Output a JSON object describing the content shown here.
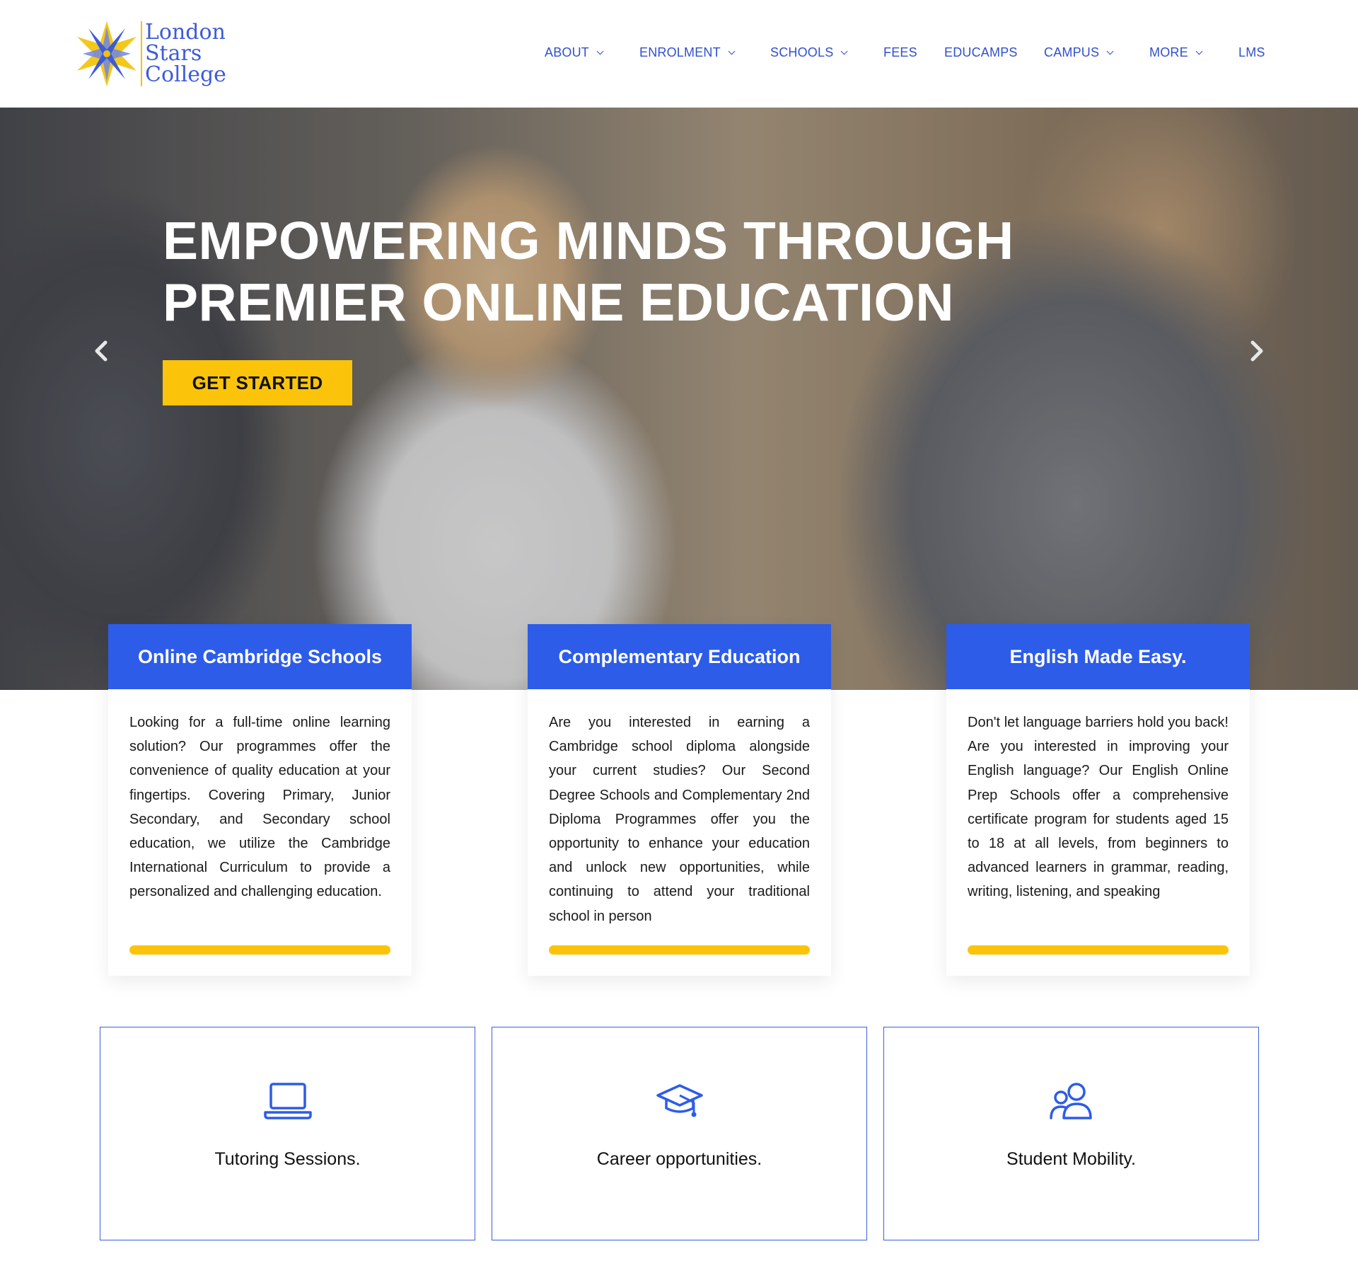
{
  "brand": {
    "line1": "London",
    "line2": "Stars",
    "line3": "College",
    "colors": {
      "blue": "#3d5bd9",
      "gold": "#f2c200"
    }
  },
  "nav": {
    "items": [
      {
        "label": "ABOUT",
        "has_dropdown": true
      },
      {
        "label": "ENROLMENT",
        "has_dropdown": true
      },
      {
        "label": "SCHOOLS",
        "has_dropdown": true
      },
      {
        "label": "FEES",
        "has_dropdown": false
      },
      {
        "label": "EDUCAMPS",
        "has_dropdown": false
      },
      {
        "label": "CAMPUS",
        "has_dropdown": true
      },
      {
        "label": "MORE",
        "has_dropdown": true
      },
      {
        "label": "LMS",
        "has_dropdown": false
      }
    ],
    "dropdown_icon": "chevron-down-icon"
  },
  "hero": {
    "title_line1": "EMPOWERING MINDS THROUGH",
    "title_line2": "PREMIER ONLINE EDUCATION",
    "cta_label": "GET STARTED",
    "prev_icon": "chevron-left-icon",
    "next_icon": "chevron-right-icon"
  },
  "cards": [
    {
      "title": "Online Cambridge Schools",
      "text": "Looking for a full-time online learning solution? Our programmes offer the convenience of quality education at your fingertips. Covering Primary, Junior Secondary, and Secondary school education, we utilize the Cambridge International Curriculum to provide a personalized and challenging education."
    },
    {
      "title": "Complementary Education",
      "text": "Are you interested in earning a Cambridge school diploma alongside your current studies? Our Second Degree Schools and Complementary 2nd Diploma Programmes offer you the opportunity to enhance your education and unlock new opportunities, while continuing to attend your traditional school in person"
    },
    {
      "title": "English Made Easy.",
      "text": "Don't let language barriers hold you back! Are you interested in improving your English language? Our English Online Prep Schools offer a comprehensive certificate program for students aged 15 to 18 at all levels, from beginners to advanced learners in grammar, reading, writing, listening, and speaking"
    }
  ],
  "services": [
    {
      "label": "Tutoring Sessions.",
      "icon": "laptop-icon"
    },
    {
      "label": "Career opportunities.",
      "icon": "graduation-cap-icon"
    },
    {
      "label": "Student Mobility.",
      "icon": "users-icon"
    }
  ],
  "colors": {
    "nav_link": "#3050cf",
    "card_header": "#2d5ce8",
    "accent_yellow": "#fbc40b",
    "service_border": "#3b5fe0"
  }
}
